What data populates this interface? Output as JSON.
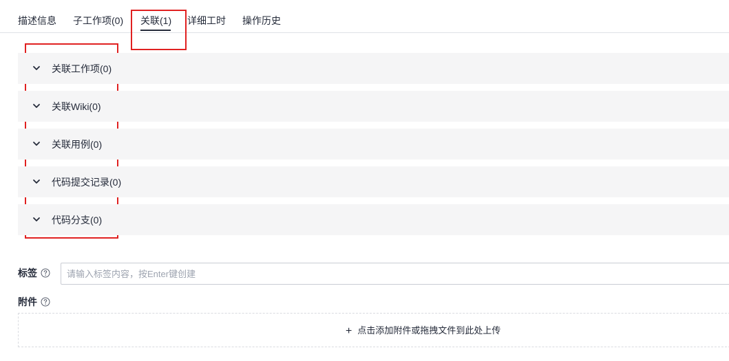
{
  "tabs": [
    {
      "label": "描述信息",
      "active": false
    },
    {
      "label": "子工作项(0)",
      "active": false
    },
    {
      "label": "关联(1)",
      "active": true
    },
    {
      "label": "详细工时",
      "active": false
    },
    {
      "label": "操作历史",
      "active": false
    }
  ],
  "sections": [
    {
      "label": "关联工作项(0)",
      "icon": "chevron-down-icon"
    },
    {
      "label": "关联Wiki(0)",
      "icon": "chevron-down-icon"
    },
    {
      "label": "关联用例(0)",
      "icon": "chevron-down-icon"
    },
    {
      "label": "代码提交记录(0)",
      "icon": "chevron-down-icon"
    },
    {
      "label": "代码分支(0)",
      "icon": "chevron-down-icon"
    }
  ],
  "tags": {
    "label": "标签",
    "icon": "help-icon",
    "placeholder": "请输入标签内容，按Enter键创建",
    "value": ""
  },
  "attachments": {
    "label": "附件",
    "icon": "help-icon",
    "upload_icon": "plus-icon",
    "upload_text": "点击添加附件或拖拽文件到此处上传"
  },
  "colors": {
    "highlight": "#e02020",
    "section_bg": "#f5f5f6",
    "text": "#252b3a"
  }
}
